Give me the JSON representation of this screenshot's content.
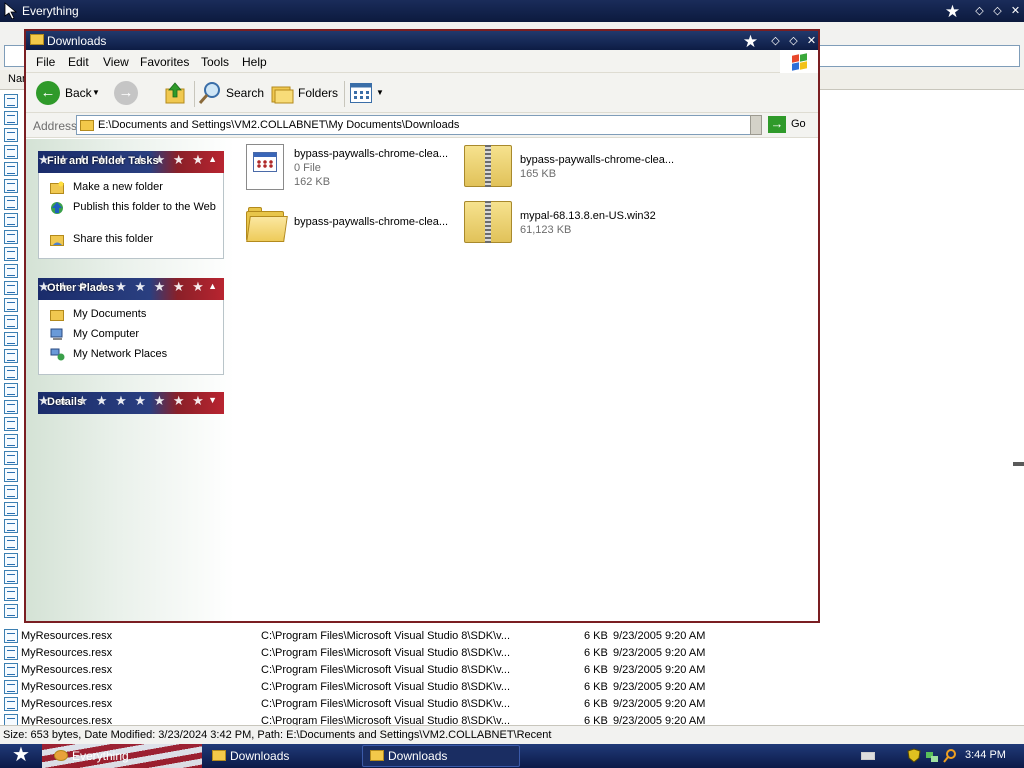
{
  "background_window": {
    "title": "Everything",
    "header_label": "Nam",
    "rows": [
      {
        "name": "MyResources.resx",
        "path": "C:\\Program Files\\Microsoft Visual Studio 8\\SDK\\v...",
        "size": "6 KB",
        "date": "9/23/2005 9:20 AM"
      },
      {
        "name": "MyResources.resx",
        "path": "C:\\Program Files\\Microsoft Visual Studio 8\\SDK\\v...",
        "size": "6 KB",
        "date": "9/23/2005 9:20 AM"
      },
      {
        "name": "MyResources.resx",
        "path": "C:\\Program Files\\Microsoft Visual Studio 8\\SDK\\v...",
        "size": "6 KB",
        "date": "9/23/2005 9:20 AM"
      },
      {
        "name": "MyResources.resx",
        "path": "C:\\Program Files\\Microsoft Visual Studio 8\\SDK\\v...",
        "size": "6 KB",
        "date": "9/23/2005 9:20 AM"
      },
      {
        "name": "MyResources.resx",
        "path": "C:\\Program Files\\Microsoft Visual Studio 8\\SDK\\v...",
        "size": "6 KB",
        "date": "9/23/2005 9:20 AM"
      },
      {
        "name": "MyResources.resx",
        "path": "C:\\Program Files\\Microsoft Visual Studio 8\\SDK\\v...",
        "size": "6 KB",
        "date": "9/23/2005 9:20 AM"
      }
    ],
    "status": "Size: 653 bytes, Date Modified: 3/23/2024 3:42 PM, Path: E:\\Documents and Settings\\VM2.COLLABNET\\Recent"
  },
  "explorer": {
    "title": "Downloads",
    "menu": [
      "File",
      "Edit",
      "View",
      "Favorites",
      "Tools",
      "Help"
    ],
    "toolbar": {
      "back": "Back",
      "search": "Search",
      "folders": "Folders"
    },
    "address": {
      "label": "Address",
      "path": "E:\\Documents and Settings\\VM2.COLLABNET\\My Documents\\Downloads",
      "go": "Go"
    },
    "file_tasks": {
      "title": "File and Folder Tasks",
      "items": [
        "Make a new folder",
        "Publish this folder to the Web",
        "Share this folder"
      ]
    },
    "other_places": {
      "title": "Other Places",
      "items": [
        "My Documents",
        "My Computer",
        "My Network Places"
      ]
    },
    "details": {
      "title": "Details"
    },
    "files": [
      {
        "name": "bypass-paywalls-chrome-clea...",
        "type": "0 File",
        "size": "162 KB",
        "icon": "document-icon"
      },
      {
        "name": "bypass-paywalls-chrome-clea...",
        "type": "",
        "size": "165 KB",
        "icon": "zip-folder-icon"
      },
      {
        "name": "bypass-paywalls-chrome-clea...",
        "type": "",
        "size": "",
        "icon": "folder-icon"
      },
      {
        "name": "mypal-68.13.8.en-US.win32",
        "type": "",
        "size": "61,123 KB",
        "icon": "zip-folder-icon"
      }
    ]
  },
  "taskbar": {
    "tasks": [
      "Everything",
      "Downloads",
      "Downloads"
    ],
    "clock": "3:44 PM"
  },
  "colors": {
    "titlebar": "#0d1c44",
    "window_border": "#7a1e22",
    "panel_blue": "#1a2c6b",
    "panel_red": "#b82430"
  }
}
